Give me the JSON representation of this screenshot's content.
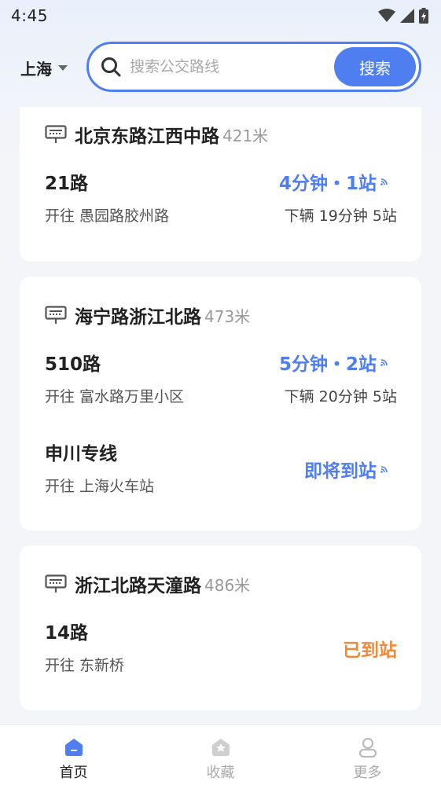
{
  "status_bar": {
    "time": "4:45"
  },
  "header": {
    "city": "上海",
    "search_placeholder": "搜索公交路线",
    "search_button": "搜索"
  },
  "stops": [
    {
      "name": "北京东路江西中路",
      "distance": "421米",
      "routes": [
        {
          "name": "21路",
          "destination": "开往 愚园路胶州路",
          "eta": "4分钟・1站",
          "next": "下辆 19分钟 5站",
          "status": "coming"
        }
      ]
    },
    {
      "name": "海宁路浙江北路",
      "distance": "473米",
      "routes": [
        {
          "name": "510路",
          "destination": "开往 富水路万里小区",
          "eta": "5分钟・2站",
          "next": "下辆 20分钟 5站",
          "status": "coming"
        },
        {
          "name": "申川专线",
          "destination": "开往 上海火车站",
          "eta": "即将到站",
          "next": "",
          "status": "coming"
        }
      ]
    },
    {
      "name": "浙江北路天潼路",
      "distance": "486米",
      "routes": [
        {
          "name": "14路",
          "destination": "开往 东新桥",
          "eta": "已到站",
          "next": "",
          "status": "arrived"
        }
      ]
    }
  ],
  "tabbar": {
    "items": [
      {
        "label": "首页",
        "icon": "home-icon",
        "active": true
      },
      {
        "label": "收藏",
        "icon": "star-icon",
        "active": false
      },
      {
        "label": "更多",
        "icon": "user-icon",
        "active": false
      }
    ]
  },
  "colors": {
    "accent": "#4f7ef0",
    "arrived": "#f08a3a"
  }
}
